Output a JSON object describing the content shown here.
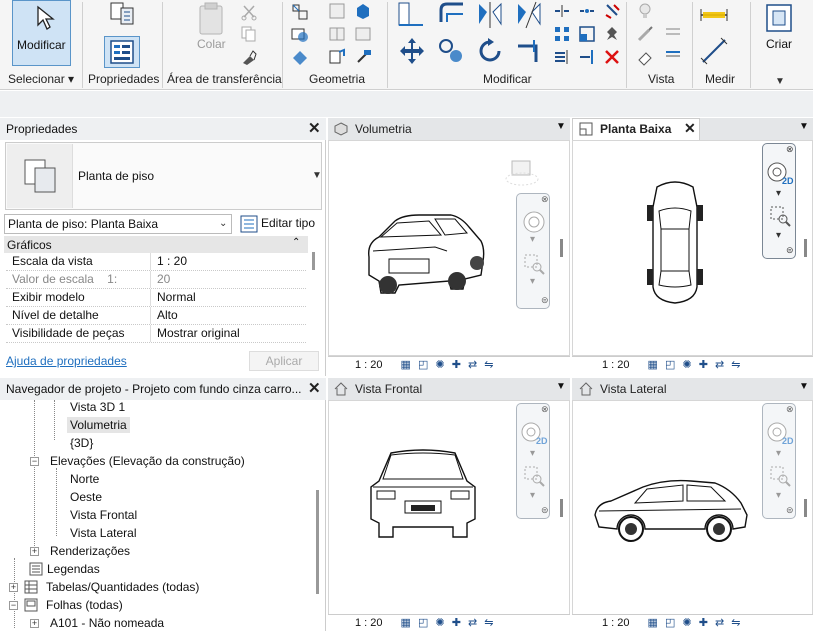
{
  "ribbon": {
    "modify_label": "Modificar",
    "panels": [
      {
        "label": "Selecionar ▾"
      },
      {
        "label": "Propriedades"
      },
      {
        "label": "Área de transferência"
      },
      {
        "label": "Geometria"
      },
      {
        "label": "Modificar"
      },
      {
        "label": "Vista"
      },
      {
        "label": "Medir"
      },
      {
        "label": "Criar"
      }
    ],
    "paste_label": "Colar",
    "create_label": "Criar"
  },
  "properties": {
    "title": "Propriedades",
    "type_name": "Planta de piso",
    "instance_selector": "Planta de piso: Planta Baixa",
    "edit_type": "Editar tipo",
    "section": "Gráficos",
    "rows": [
      {
        "key": "Escala da vista",
        "value": "1 : 20"
      },
      {
        "key": "Valor de escala    1:",
        "value": "20"
      },
      {
        "key": "Exibir modelo",
        "value": "Normal"
      },
      {
        "key": "Nível de detalhe",
        "value": "Alto"
      },
      {
        "key": "Visibilidade de peças",
        "value": "Mostrar original"
      }
    ],
    "help_link": "Ajuda de propriedades",
    "apply": "Aplicar"
  },
  "browser": {
    "title": "Navegador de projeto - Projeto com fundo cinza carro...",
    "items": [
      {
        "label": "Vista 3D 1"
      },
      {
        "label": "Volumetria"
      },
      {
        "label": "{3D}"
      },
      {
        "label": "Elevações (Elevação da construção)"
      },
      {
        "label": "Norte"
      },
      {
        "label": "Oeste"
      },
      {
        "label": "Vista Frontal"
      },
      {
        "label": "Vista Lateral"
      },
      {
        "label": "Renderizações"
      },
      {
        "label": "Legendas"
      },
      {
        "label": "Tabelas/Quantidades (todas)"
      },
      {
        "label": "Folhas (todas)"
      },
      {
        "label": "A101 - Não nomeada"
      }
    ]
  },
  "views": [
    {
      "title": "Volumetria",
      "scale": "1 : 20"
    },
    {
      "title": "Planta Baixa",
      "scale": "1 : 20"
    },
    {
      "title": "Vista Frontal",
      "scale": "1 : 20"
    },
    {
      "title": "Vista Lateral",
      "scale": "1 : 20"
    }
  ],
  "colors": {
    "accent": "#1f6fbf",
    "active_button": "#cfe3f5"
  }
}
